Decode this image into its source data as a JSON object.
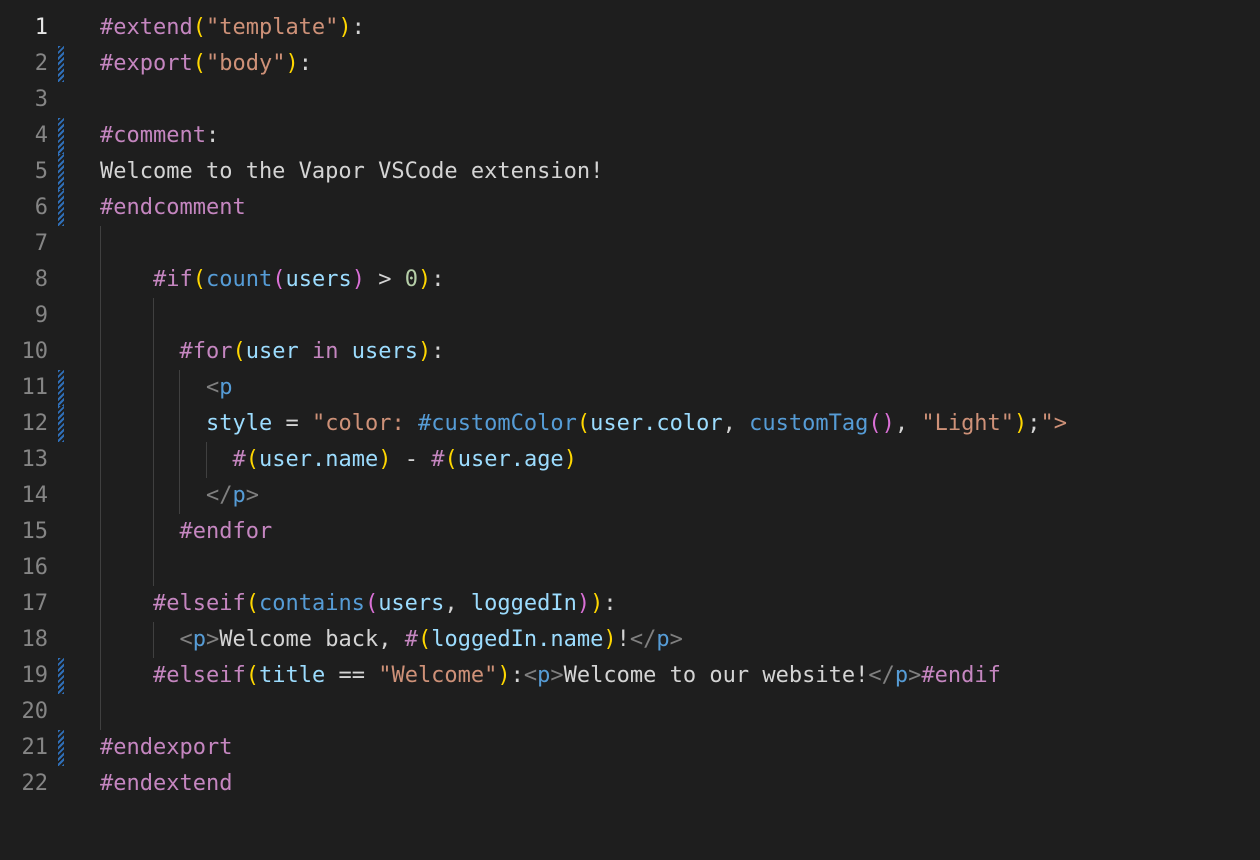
{
  "editor": {
    "theme_colors": {
      "background": "#1e1e1e",
      "tag": "#c586c0",
      "function": "#569cd6",
      "string": "#ce9178",
      "variable": "#9cdcfe",
      "number": "#b5cea8"
    },
    "lines": [
      {
        "n": "1",
        "text": "#extend(\"template\"):"
      },
      {
        "n": "2",
        "text": "#export(\"body\"):"
      },
      {
        "n": "3",
        "text": ""
      },
      {
        "n": "4",
        "text": "#comment:"
      },
      {
        "n": "5",
        "text": "Welcome to the Vapor VSCode extension!"
      },
      {
        "n": "6",
        "text": "#endcomment"
      },
      {
        "n": "7",
        "text": ""
      },
      {
        "n": "8",
        "text": "    #if(count(users) > 0):"
      },
      {
        "n": "9",
        "text": ""
      },
      {
        "n": "10",
        "text": "      #for(user in users):"
      },
      {
        "n": "11",
        "text": "        <p"
      },
      {
        "n": "12",
        "text": "        style = \"color: #customColor(user.color, customTag(), \"Light\");\">"
      },
      {
        "n": "13",
        "text": "          #(user.name) - #(user.age)"
      },
      {
        "n": "14",
        "text": "        </p>"
      },
      {
        "n": "15",
        "text": "      #endfor"
      },
      {
        "n": "16",
        "text": ""
      },
      {
        "n": "17",
        "text": "    #elseif(contains(users, loggedIn)):"
      },
      {
        "n": "18",
        "text": "      <p>Welcome back, #(loggedIn.name)!</p>"
      },
      {
        "n": "19",
        "text": "    #elseif(title == \"Welcome\"):<p>Welcome to our website!</p>#endif"
      },
      {
        "n": "20",
        "text": ""
      },
      {
        "n": "21",
        "text": "#endexport"
      },
      {
        "n": "22",
        "text": "#endextend"
      }
    ]
  }
}
